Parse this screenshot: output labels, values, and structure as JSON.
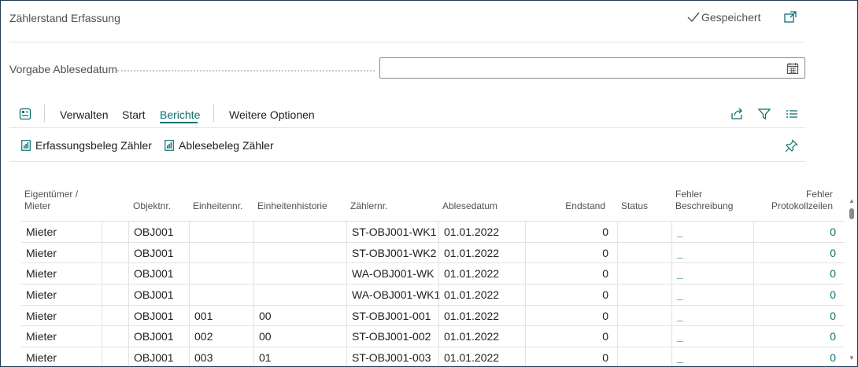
{
  "page": {
    "title": "Zählerstand Erfassung",
    "saved_label": "Gespeichert"
  },
  "filter": {
    "date_label": "Vorgabe Ablesedatum",
    "date_value": ""
  },
  "actionbar": {
    "items": [
      "Verwalten",
      "Start",
      "Berichte",
      "Weitere Optionen"
    ],
    "active": "Berichte"
  },
  "reports": {
    "btn1": "Erfassungsbeleg Zähler",
    "btn2": "Ablesebeleg Zähler"
  },
  "table": {
    "headers": {
      "owner_l1": "Eigentümer /",
      "owner_l2": "Mieter",
      "object": "Objektnr.",
      "unit": "Einheitennr.",
      "history": "Einheitenhistorie",
      "meter": "Zählernr.",
      "date": "Ablesedatum",
      "end": "Endstand",
      "status": "Status",
      "err_l1": "Fehler",
      "err_l2": "Beschreibung",
      "log_l1": "Fehler",
      "log_l2": "Protokollzeilen"
    },
    "rows": [
      {
        "owner": "Mieter",
        "object": "OBJ001",
        "unit": "",
        "history": "",
        "meter": "ST-OBJ001-WK1",
        "date": "01.01.2022",
        "end": "0",
        "status": "",
        "err": "_",
        "log": "0"
      },
      {
        "owner": "Mieter",
        "object": "OBJ001",
        "unit": "",
        "history": "",
        "meter": "ST-OBJ001-WK2",
        "date": "01.01.2022",
        "end": "0",
        "status": "",
        "err": "_",
        "log": "0"
      },
      {
        "owner": "Mieter",
        "object": "OBJ001",
        "unit": "",
        "history": "",
        "meter": "WA-OBJ001-WK",
        "date": "01.01.2022",
        "end": "0",
        "status": "",
        "err": "_",
        "log": "0"
      },
      {
        "owner": "Mieter",
        "object": "OBJ001",
        "unit": "",
        "history": "",
        "meter": "WA-OBJ001-WK1",
        "date": "01.01.2022",
        "end": "0",
        "status": "",
        "err": "_",
        "log": "0"
      },
      {
        "owner": "Mieter",
        "object": "OBJ001",
        "unit": "001",
        "history": "00",
        "meter": "ST-OBJ001-001",
        "date": "01.01.2022",
        "end": "0",
        "status": "",
        "err": "_",
        "log": "0"
      },
      {
        "owner": "Mieter",
        "object": "OBJ001",
        "unit": "002",
        "history": "00",
        "meter": "ST-OBJ001-002",
        "date": "01.01.2022",
        "end": "0",
        "status": "",
        "err": "_",
        "log": "0"
      },
      {
        "owner": "Mieter",
        "object": "OBJ001",
        "unit": "003",
        "history": "01",
        "meter": "ST-OBJ001-003",
        "date": "01.01.2022",
        "end": "0",
        "status": "",
        "err": "_",
        "log": "0"
      }
    ]
  },
  "colors": {
    "accent": "#0f6f6f",
    "text": "#212121",
    "muted": "#505050",
    "border": "#1f3b57"
  },
  "icons": [
    "check-icon",
    "popout-icon",
    "calendar-icon",
    "page-layout-icon",
    "share-icon",
    "filter-icon",
    "list-icon",
    "report-icon",
    "pin-icon"
  ]
}
